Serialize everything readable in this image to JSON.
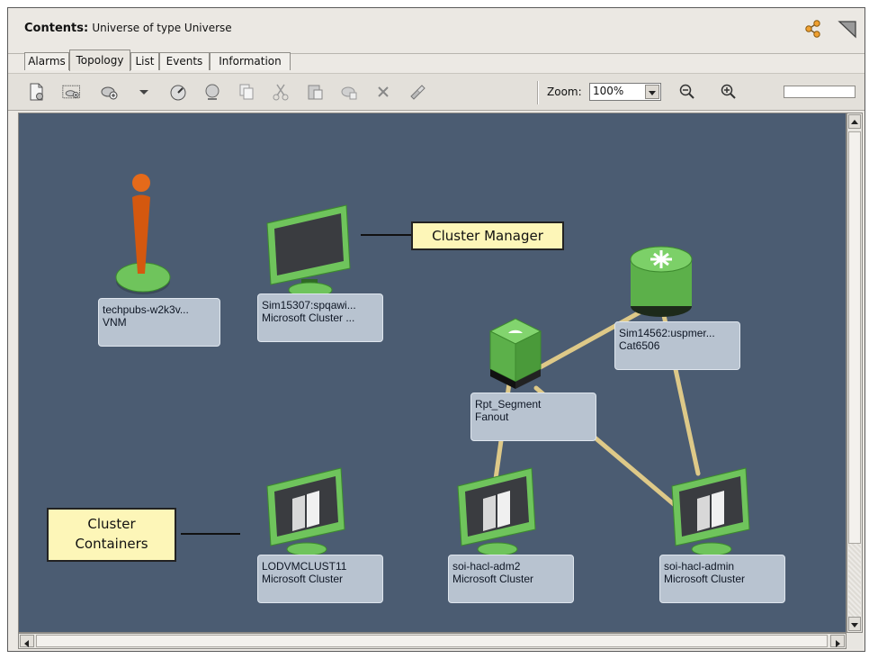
{
  "header": {
    "contents_label": "Contents:",
    "contents_value": "Universe of type Universe"
  },
  "tabs": [
    {
      "label": "Alarms"
    },
    {
      "label": "Topology"
    },
    {
      "label": "List"
    },
    {
      "label": "Events"
    },
    {
      "label": "Information"
    }
  ],
  "toolbar": {
    "zoom_label": "Zoom:",
    "zoom_value": "100%"
  },
  "nodes": [
    {
      "line1": "techpubs-w2k3v...",
      "line2": "VNM"
    },
    {
      "line1": "Sim15307:spqawi...",
      "line2": "Microsoft Cluster ..."
    },
    {
      "line1": "Sim14562:uspmer...",
      "line2": "Cat6506"
    },
    {
      "line1": "Rpt_Segment",
      "line2": "Fanout"
    },
    {
      "line1": "LODVMCLUST11",
      "line2": "Microsoft Cluster"
    },
    {
      "line1": "soi-hacl-adm2",
      "line2": "Microsoft Cluster"
    },
    {
      "line1": "soi-hacl-admin",
      "line2": "Microsoft Cluster"
    }
  ],
  "callouts": {
    "cluster_manager": "Cluster Manager",
    "cluster_containers_line1": "Cluster",
    "cluster_containers_line2": "Containers"
  },
  "colors": {
    "canvas": "#4b5c72",
    "node_green": "#6fc45c",
    "link_yellow": "#e6cf8a",
    "callout_bg": "#fdf6b8"
  }
}
